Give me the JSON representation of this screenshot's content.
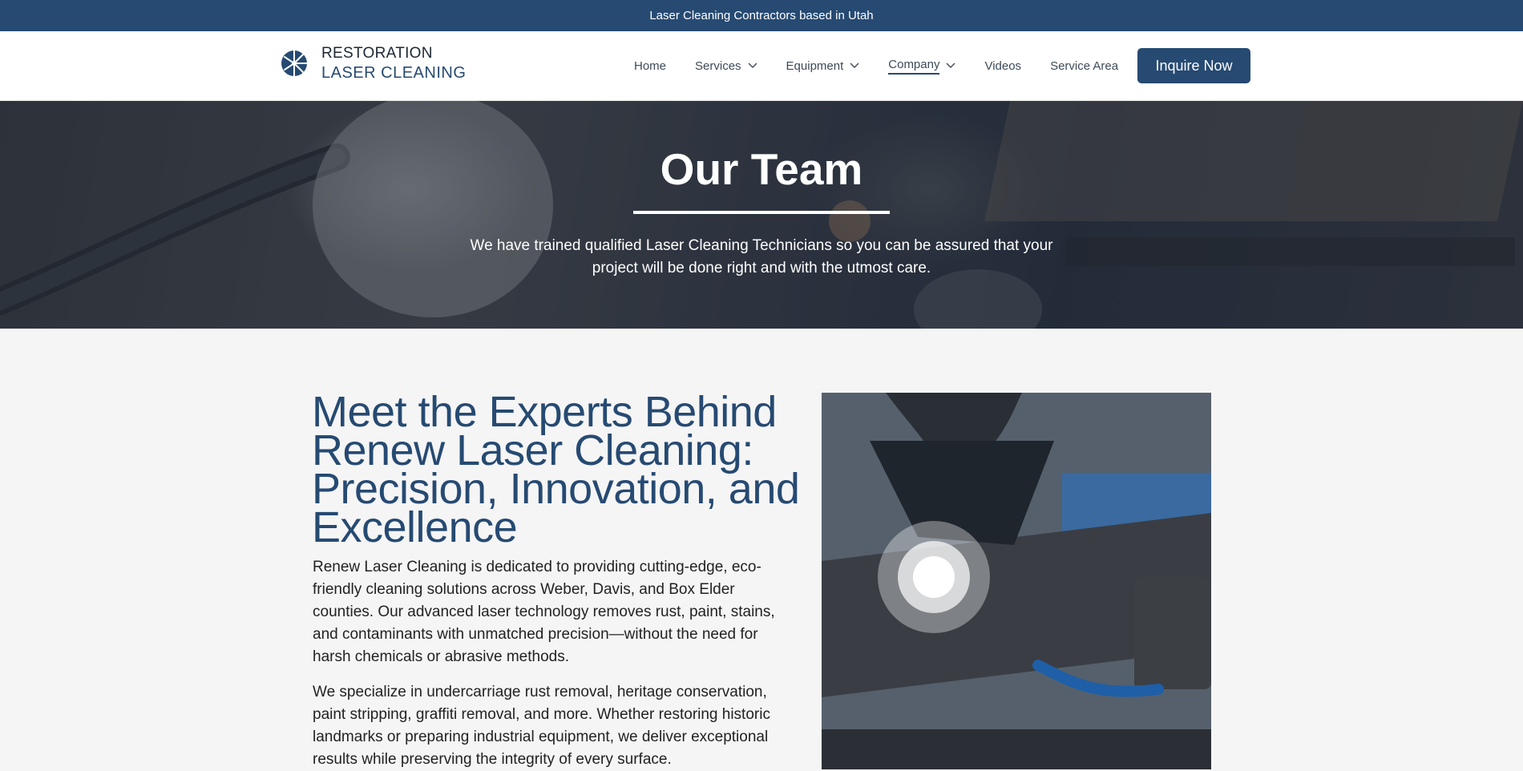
{
  "topbar": {
    "text": "Laser Cleaning Contractors based in Utah"
  },
  "brand": {
    "line1": "RESTORATION",
    "line2": "LASER CLEANING"
  },
  "nav": {
    "items": [
      {
        "label": "Home",
        "has_dropdown": false,
        "active": false
      },
      {
        "label": "Services",
        "has_dropdown": true,
        "active": false
      },
      {
        "label": "Equipment",
        "has_dropdown": true,
        "active": false
      },
      {
        "label": "Company",
        "has_dropdown": true,
        "active": true
      },
      {
        "label": "Videos",
        "has_dropdown": false,
        "active": false
      },
      {
        "label": "Service Area",
        "has_dropdown": false,
        "active": false
      }
    ],
    "cta_label": "Inquire Now"
  },
  "hero": {
    "title": "Our Team",
    "subtitle": "We have trained qualified Laser Cleaning Technicians so you can be assured that your project will be done right and with the utmost care."
  },
  "main": {
    "heading": "Meet the Experts Behind Renew Laser Cleaning: Precision, Innovation, and Excellence",
    "paragraphs": [
      "Renew Laser Cleaning is dedicated to providing cutting-edge, eco-friendly cleaning solutions across Weber, Davis, and Box Elder counties. Our advanced laser technology removes rust, paint, stains, and contaminants with unmatched precision—without the need for harsh chemicals or abrasive methods.",
      "We specialize in undercarriage rust removal, heritage conservation, paint stripping, graffiti removal, and more. Whether restoring historic landmarks or preparing industrial equipment, we deliver exceptional results while preserving the integrity of every surface."
    ]
  },
  "colors": {
    "brand_navy": "#264a72",
    "page_bg": "#f5f5f5",
    "text_dark": "#222222"
  },
  "icons": {
    "logo": "laser-burst-icon",
    "dropdown": "chevron-down-icon"
  }
}
